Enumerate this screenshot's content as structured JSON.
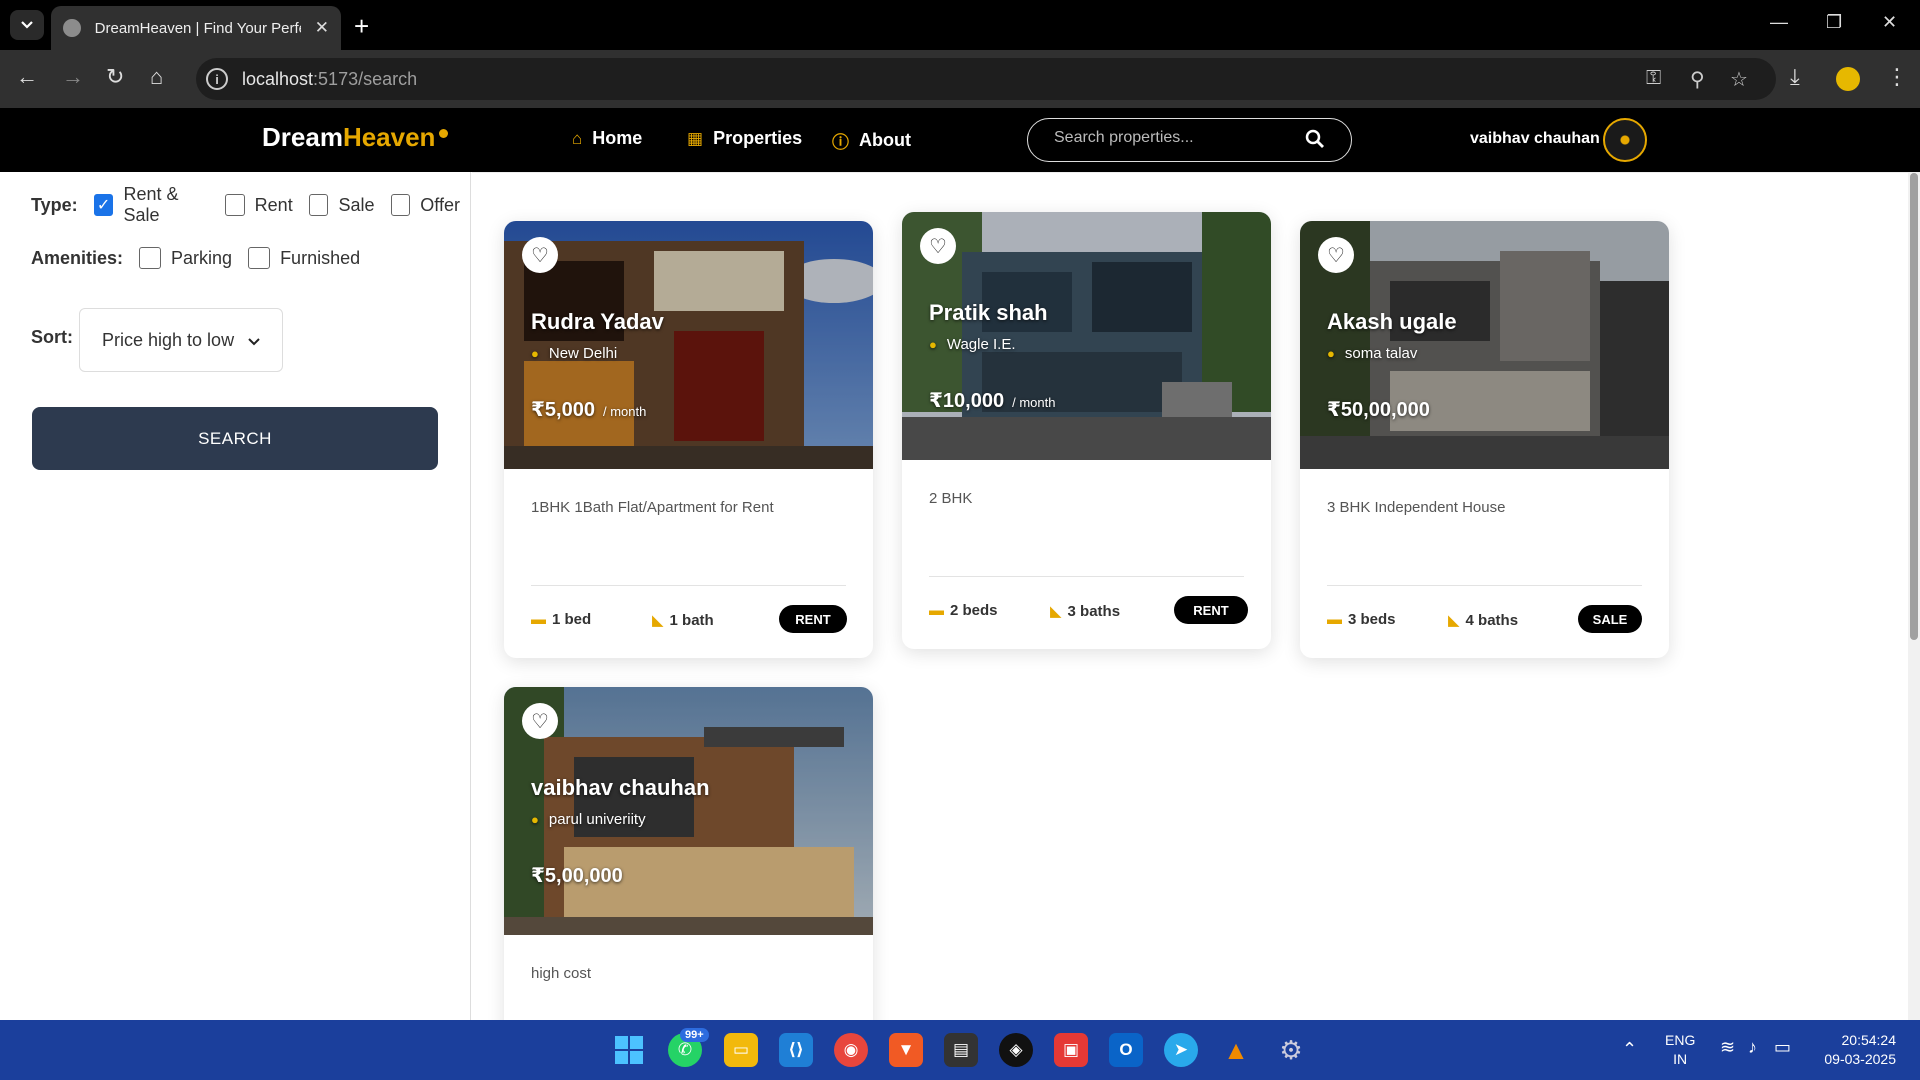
{
  "browser": {
    "tab_title": "DreamHeaven | Find Your Perfect",
    "url_host": "localhost",
    "url_path": ":5173/search"
  },
  "app": {
    "logo_part1": "Dream",
    "logo_part2": "Heaven",
    "nav": [
      {
        "label": "Home",
        "icon": "home-icon"
      },
      {
        "label": "Properties",
        "icon": "building-icon"
      },
      {
        "label": "About",
        "icon": "info-icon"
      }
    ],
    "search_placeholder": "Search properties...",
    "user_name": "vaibhav chauhan",
    "accent_color": "#e6a800"
  },
  "filters": {
    "type_label": "Type:",
    "type_options": [
      {
        "label": "Rent & Sale",
        "checked": true
      },
      {
        "label": "Rent",
        "checked": false
      },
      {
        "label": "Sale",
        "checked": false
      },
      {
        "label": "Offer",
        "checked": false
      }
    ],
    "amenities_label": "Amenities:",
    "amenity_options": [
      {
        "label": "Parking",
        "checked": false
      },
      {
        "label": "Furnished",
        "checked": false
      }
    ],
    "sort_label": "Sort:",
    "sort_value": "Price high to low",
    "search_button": "SEARCH"
  },
  "listings": [
    {
      "owner": "Rudra Yadav",
      "location": "New Delhi",
      "price": "₹5,000",
      "per": "/ month",
      "desc": "1BHK 1Bath Flat/Apartment for Rent",
      "beds": "1 bed",
      "baths": "1 bath",
      "badge": "RENT"
    },
    {
      "owner": "Pratik shah",
      "location": "Wagle I.E.",
      "price": "₹10,000",
      "per": "/ month",
      "desc": "2 BHK",
      "beds": "2 beds",
      "baths": "3 baths",
      "badge": "RENT"
    },
    {
      "owner": "Akash ugale",
      "location": "soma talav",
      "price": "₹50,00,000",
      "per": "",
      "desc": "3 BHK Independent House",
      "beds": "3 beds",
      "baths": "4 baths",
      "badge": "SALE"
    },
    {
      "owner": "vaibhav chauhan",
      "location": "parul univeriity",
      "price": "₹5,00,000",
      "per": "",
      "desc": "high cost"
    }
  ],
  "taskbar": {
    "whatsapp_badge": "99+",
    "lang_line1": "ENG",
    "lang_line2": "IN",
    "time": "20:54:24",
    "date": "09-03-2025"
  }
}
